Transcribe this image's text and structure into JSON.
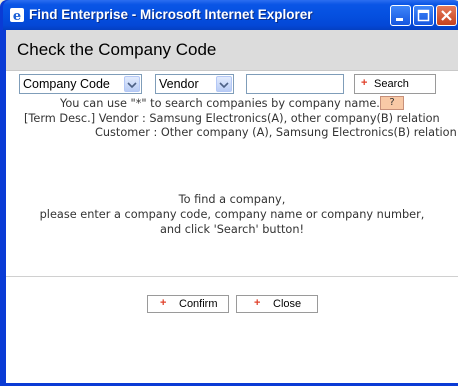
{
  "window": {
    "title": "Find Enterprise - Microsoft Internet Explorer"
  },
  "page": {
    "title": "Check the Company Code"
  },
  "search": {
    "type_select": "Company Code",
    "relation_select": "Vendor",
    "query_value": "",
    "search_button": "Search"
  },
  "info": {
    "wildcard_hint": "You can use \"*\" to search companies by company name.",
    "help_button": "?",
    "term_vendor": "[Term Desc.]   Vendor : Samsung Electronics(A), other company(B) relation",
    "term_customer": "Customer : Other company (A), Samsung Electronics(B) relation"
  },
  "instructions": {
    "line1": "To find a company,",
    "line2": "please enter a company code, company name or company number,",
    "line3": "and click 'Search' button!"
  },
  "footer": {
    "confirm": "Confirm",
    "close": "Close"
  },
  "colors": {
    "title_bar": "#0a55e6",
    "header_bg": "#dcdcdc",
    "plus_icon": "#e0402a",
    "help_bg": "#f8c9a6"
  }
}
